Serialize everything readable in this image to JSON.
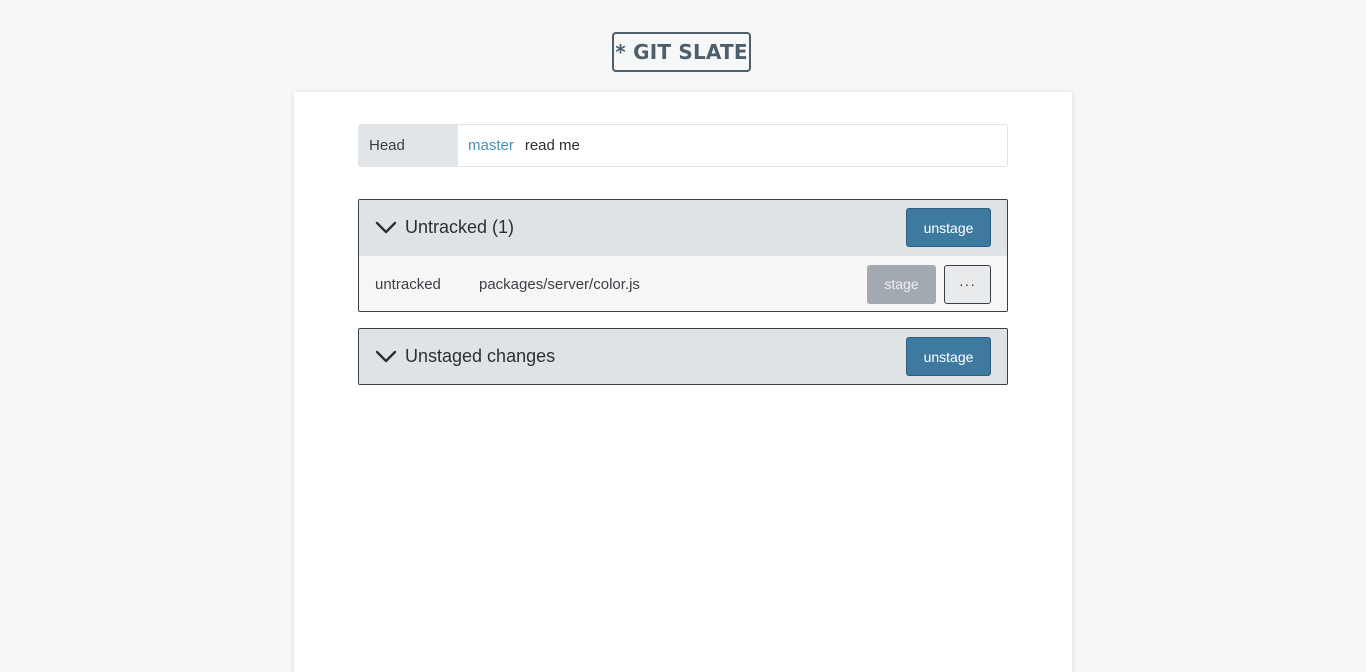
{
  "app": {
    "logo_text": "* GIT SLATE"
  },
  "head": {
    "label": "Head",
    "branch": "master",
    "commit_message": "read me"
  },
  "sections": {
    "untracked": {
      "title": "Untracked (1)",
      "action_label": "unstage",
      "files": [
        {
          "status": "untracked",
          "path": "packages/server/color.js",
          "stage_label": "stage",
          "more_label": "···"
        }
      ]
    },
    "unstaged": {
      "title": "Unstaged changes",
      "action_label": "unstage"
    }
  },
  "colors": {
    "accent": "#3e7aa0",
    "branch": "#4a90b8",
    "disabled": "#a2a9b0"
  },
  "icons": {
    "section_toggle": "chevron-down-icon",
    "more": "ellipsis-icon"
  }
}
